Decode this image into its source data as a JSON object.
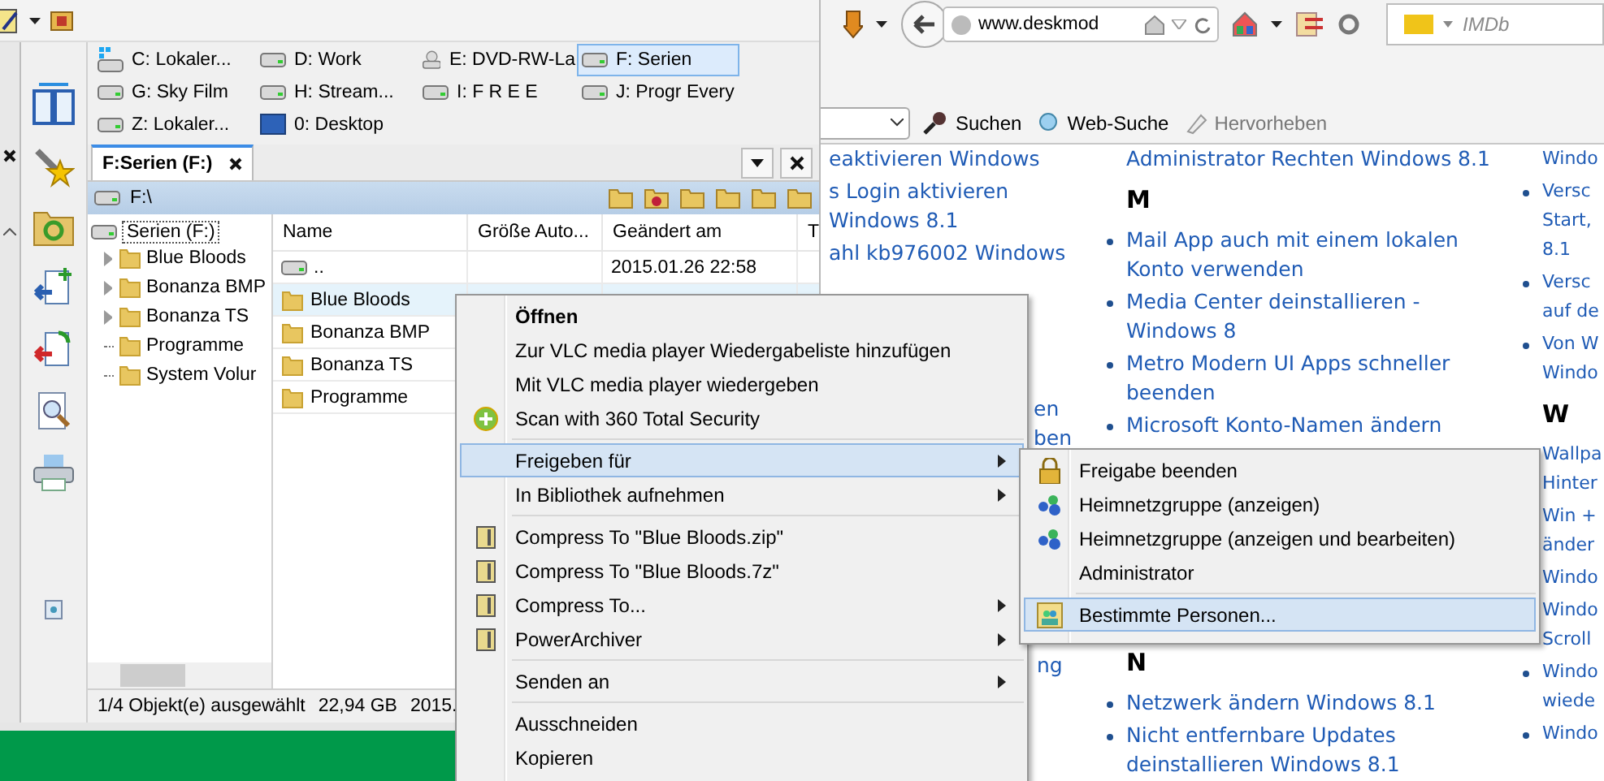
{
  "file_manager": {
    "drives": [
      {
        "label": "C: Lokaler...",
        "kind": "system",
        "selected": false
      },
      {
        "label": "D: Work",
        "kind": "hdd",
        "selected": false
      },
      {
        "label": "E: DVD-RW-La",
        "kind": "dvd",
        "selected": false
      },
      {
        "label": "F: Serien",
        "kind": "hdd",
        "selected": true
      },
      {
        "label": "G: Sky Film",
        "kind": "hdd",
        "selected": false
      },
      {
        "label": "H: Stream...",
        "kind": "hdd",
        "selected": false
      },
      {
        "label": "I: F R E E",
        "kind": "hdd",
        "selected": false
      },
      {
        "label": "J: Progr Every",
        "kind": "hdd",
        "selected": false
      },
      {
        "label": "Z: Lokaler...",
        "kind": "hdd",
        "selected": false
      },
      {
        "label": "0: Desktop",
        "kind": "desktop",
        "selected": false
      }
    ],
    "tab": "F:Serien (F:)",
    "path": "F:\\",
    "tree": {
      "root": "Serien (F:)",
      "children": [
        {
          "label": "Blue Bloods",
          "expandable": true
        },
        {
          "label": "Bonanza BMP",
          "expandable": true
        },
        {
          "label": "Bonanza TS",
          "expandable": true
        },
        {
          "label": "Programme",
          "expandable": false
        },
        {
          "label": "System Volur",
          "expandable": false
        }
      ]
    },
    "columns": [
      "Name",
      "Größe Auto...",
      "Geändert am",
      "T"
    ],
    "rows": [
      {
        "name": "..",
        "kind": "up",
        "modified": "2015.01.26 22:58",
        "selected": false
      },
      {
        "name": "Blue Bloods",
        "kind": "folder",
        "selected": true
      },
      {
        "name": "Bonanza BMP",
        "kind": "folder",
        "selected": false
      },
      {
        "name": "Bonanza TS",
        "kind": "folder",
        "selected": false
      },
      {
        "name": "Programme",
        "kind": "folder",
        "selected": false
      }
    ],
    "status": [
      "1/4 Objekt(e) ausgewählt",
      "22,94 GB",
      "2015."
    ]
  },
  "browser": {
    "url": "www.deskmod",
    "search_placeholder": "IMDb",
    "find_bar": [
      {
        "label": "Suchen",
        "kind": "search",
        "disabled": false
      },
      {
        "label": "Web-Suche",
        "kind": "web",
        "disabled": false
      },
      {
        "label": "Hervorheben",
        "kind": "highlight",
        "disabled": true
      }
    ],
    "page_columns": [
      {
        "groups": [
          {
            "items": [
              {
                "kind": "text",
                "lines": [
                  "eaktivieren Windows"
                ]
              },
              {
                "kind": "text",
                "lines": [
                  "s Login aktivieren",
                  "Windows 8.1"
                ]
              },
              {
                "kind": "text",
                "lines": [
                  "ahl kb976002 Windows"
                ]
              }
            ]
          },
          {
            "items": [
              {
                "kind": "text",
                "lines": [
                  "en",
                  "ben"
                ]
              }
            ]
          },
          {
            "items": [
              {
                "kind": "text",
                "lines": [
                  "ng"
                ]
              }
            ]
          }
        ]
      },
      {
        "groups": [
          {
            "items": [
              {
                "kind": "text",
                "lines": [
                  "Administrator Rechten Windows 8.1"
                ]
              },
              {
                "kind": "heading",
                "lines": [
                  "M"
                ]
              },
              {
                "kind": "bullet",
                "lines": [
                  "Mail App auch mit einem lokalen",
                  "Konto verwenden"
                ]
              },
              {
                "kind": "bullet",
                "lines": [
                  "Media Center deinstallieren -",
                  "Windows 8"
                ]
              },
              {
                "kind": "bullet",
                "lines": [
                  "Metro Modern UI Apps schneller",
                  "beenden"
                ]
              },
              {
                "kind": "bullet",
                "lines": [
                  "Microsoft Konto-Namen ändern"
                ]
              }
            ]
          },
          {
            "items": [
              {
                "kind": "heading",
                "lines": [
                  "N"
                ]
              },
              {
                "kind": "bullet",
                "lines": [
                  "Netzwerk ändern Windows 8.1"
                ]
              },
              {
                "kind": "bullet",
                "lines": [
                  "Nicht entfernbare Updates",
                  "deinstallieren Windows 8.1"
                ]
              }
            ]
          }
        ]
      },
      {
        "groups": [
          {
            "items": [
              {
                "kind": "text",
                "lines": [
                  "Windo"
                ]
              },
              {
                "kind": "bullet",
                "lines": [
                  "Versc",
                  "Start,",
                  "8.1"
                ]
              },
              {
                "kind": "bullet",
                "lines": [
                  "Versc",
                  "auf de"
                ]
              },
              {
                "kind": "bullet",
                "lines": [
                  "Von W",
                  "Windo"
                ]
              },
              {
                "kind": "heading",
                "lines": [
                  "W"
                ]
              },
              {
                "kind": "text",
                "lines": [
                  "Wallpa",
                  "Hinter"
                ]
              },
              {
                "kind": "text",
                "lines": [
                  "Win +",
                  "änder"
                ]
              },
              {
                "kind": "text",
                "lines": [
                  "Windo"
                ]
              },
              {
                "kind": "text",
                "lines": [
                  "Windo",
                  "Scroll"
                ]
              },
              {
                "kind": "bullet",
                "lines": [
                  "Windo",
                  "wiede"
                ]
              },
              {
                "kind": "bullet",
                "lines": [
                  "Windo"
                ]
              }
            ]
          }
        ]
      }
    ]
  },
  "context_menu": [
    {
      "kind": "plain",
      "label": "Öffnen",
      "bold": true,
      "submenu": false,
      "selected": false
    },
    {
      "kind": "plain",
      "label": "Zur VLC media player Wiedergabeliste hinzufügen",
      "bold": false,
      "submenu": false,
      "selected": false
    },
    {
      "kind": "plain",
      "label": "Mit VLC media player wiedergeben",
      "bold": false,
      "submenu": false,
      "selected": false
    },
    {
      "kind": "scan",
      "label": "Scan with 360 Total Security",
      "bold": false,
      "submenu": false,
      "selected": false
    },
    {
      "kind": "separator"
    },
    {
      "kind": "plain",
      "label": "Freigeben für",
      "bold": false,
      "submenu": true,
      "selected": true
    },
    {
      "kind": "plain",
      "label": "In Bibliothek aufnehmen",
      "bold": false,
      "submenu": true,
      "selected": false
    },
    {
      "kind": "separator"
    },
    {
      "kind": "archive",
      "label": "Compress To \"Blue Bloods.zip\"",
      "bold": false,
      "submenu": false,
      "selected": false
    },
    {
      "kind": "archive",
      "label": "Compress To \"Blue Bloods.7z\"",
      "bold": false,
      "submenu": false,
      "selected": false
    },
    {
      "kind": "archive",
      "label": "Compress To...",
      "bold": false,
      "submenu": true,
      "selected": false
    },
    {
      "kind": "archive",
      "label": "PowerArchiver",
      "bold": false,
      "submenu": true,
      "selected": false
    },
    {
      "kind": "separator"
    },
    {
      "kind": "plain",
      "label": "Senden an",
      "bold": false,
      "submenu": true,
      "selected": false
    },
    {
      "kind": "separator"
    },
    {
      "kind": "plain",
      "label": "Ausschneiden",
      "bold": false,
      "submenu": false,
      "selected": false
    },
    {
      "kind": "plain",
      "label": "Kopieren",
      "bold": false,
      "submenu": false,
      "selected": false
    }
  ],
  "submenu": [
    {
      "kind": "lock",
      "label": "Freigabe beenden",
      "selected": false
    },
    {
      "kind": "homegroup",
      "label": "Heimnetzgruppe (anzeigen)",
      "selected": false
    },
    {
      "kind": "homegroup",
      "label": "Heimnetzgruppe (anzeigen und bearbeiten)",
      "selected": false
    },
    {
      "kind": "plain",
      "label": "Administrator",
      "selected": false
    },
    {
      "kind": "separator"
    },
    {
      "kind": "people",
      "label": "Bestimmte Personen...",
      "selected": true
    }
  ]
}
